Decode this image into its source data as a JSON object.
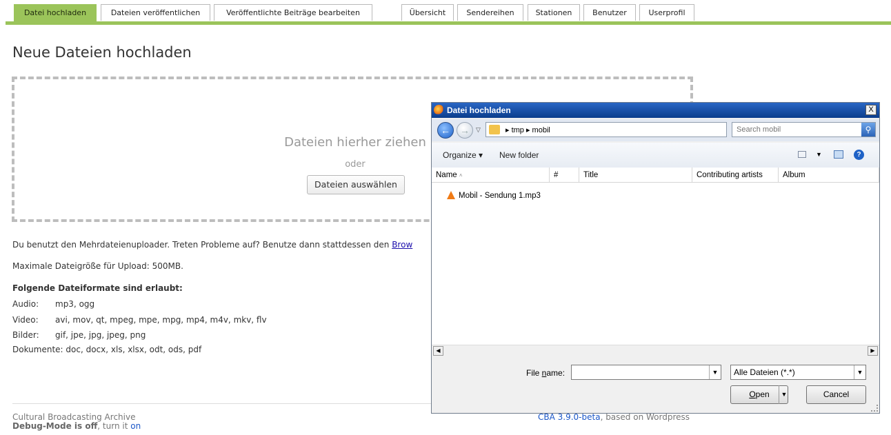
{
  "nav": {
    "tabs": [
      {
        "label": "Datei hochladen",
        "active": true
      },
      {
        "label": "Dateien veröffentlichen",
        "active": false
      },
      {
        "label": "Veröffentlichte Beiträge bearbeiten",
        "active": false
      },
      {
        "label": "Übersicht",
        "active": false
      },
      {
        "label": "Sendereihen",
        "active": false
      },
      {
        "label": "Stationen",
        "active": false
      },
      {
        "label": "Benutzer",
        "active": false
      },
      {
        "label": "Userprofil",
        "active": false
      }
    ],
    "accent_color": "#9bc45a"
  },
  "page": {
    "title": "Neue Dateien hochladen",
    "dropzone": {
      "main_text": "Dateien hierher ziehen",
      "or_text": "oder",
      "select_button": "Dateien auswählen"
    },
    "info_multi": "Du benutzt den Mehrdateienuploader. Treten Probleme auf? Benutze dann stattdessen den ",
    "info_multi_link": "Brow",
    "max_size": "Maximale Dateigröße für Upload: 500MB.",
    "formats_title": "Folgende Dateiformate sind erlaubt:",
    "formats": [
      {
        "label": "Audio:",
        "value": "mp3, ogg"
      },
      {
        "label": "Video:",
        "value": "avi, mov, qt, mpeg, mpe, mpg, mp4, m4v, mkv, flv"
      },
      {
        "label": "Bilder:",
        "value": "gif, jpe, jpg, jpeg, png"
      },
      {
        "label": "Dokumente:",
        "value": "doc, docx, xls, xlsx, odt, ods, pdf"
      }
    ]
  },
  "footer": {
    "site_name": "Cultural Broadcasting Archive",
    "debug_label": "Debug-Mode is off",
    "debug_mid": ", turn it ",
    "debug_link": "on",
    "version_link": "CBA 3.9.0-beta",
    "version_suffix": ", based on Wordpress"
  },
  "dialog": {
    "title": "Datei hochladen",
    "close": "X",
    "path": "▸ tmp ▸ mobil",
    "search_placeholder": "Search mobil",
    "organize": "Organize ▾",
    "new_folder": "New folder",
    "columns": [
      "Name",
      "#",
      "Title",
      "Contributing artists",
      "Album"
    ],
    "files": [
      {
        "name": "Mobil - Sendung 1.mp3",
        "icon": "vlc-cone-icon"
      }
    ],
    "filename_label_pre": "File ",
    "filename_label_u": "n",
    "filename_label_post": "ame:",
    "filename_value": "",
    "filetype": "Alle Dateien (*.*)",
    "open_u": "O",
    "open_rest": "pen",
    "cancel": "Cancel"
  }
}
